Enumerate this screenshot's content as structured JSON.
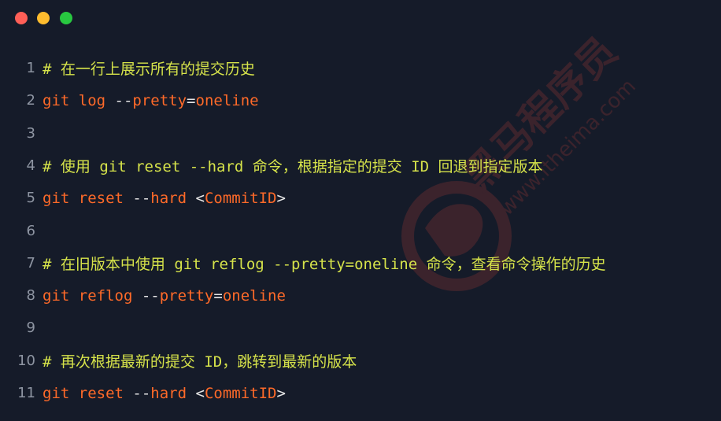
{
  "window": {
    "traffic_lights": {
      "close_color": "#ff5f57",
      "minimize_color": "#febc2e",
      "maximize_color": "#28c840"
    }
  },
  "watermark": {
    "text_cn": "黑马程序员",
    "text_url": "www.itheima.com",
    "color": "#5a2a30"
  },
  "colors": {
    "background": "#151b29",
    "comment": "#d6e34a",
    "command": "#ff6a29",
    "plain": "#e6e6e6",
    "line_number": "#8e95a2"
  },
  "code_lines": [
    {
      "number": "1",
      "comment": "# 在一行上展示所有的提交历史"
    },
    {
      "number": "2",
      "tokens": [
        {
          "t": "git log ",
          "c": "cmd"
        },
        {
          "t": "--",
          "c": "plain"
        },
        {
          "t": "pretty",
          "c": "cmd"
        },
        {
          "t": "=",
          "c": "plain"
        },
        {
          "t": "oneline",
          "c": "cmd"
        }
      ]
    },
    {
      "number": "3"
    },
    {
      "number": "4",
      "comment": "# 使用 git reset --hard 命令，根据指定的提交 ID 回退到指定版本"
    },
    {
      "number": "5",
      "tokens": [
        {
          "t": "git reset ",
          "c": "cmd"
        },
        {
          "t": "--",
          "c": "plain"
        },
        {
          "t": "hard ",
          "c": "cmd"
        },
        {
          "t": "<",
          "c": "plain"
        },
        {
          "t": "CommitID",
          "c": "cmd"
        },
        {
          "t": ">",
          "c": "plain"
        }
      ]
    },
    {
      "number": "6"
    },
    {
      "number": "7",
      "comment": "# 在旧版本中使用 git reflog --pretty=oneline 命令，查看命令操作的历史"
    },
    {
      "number": "8",
      "tokens": [
        {
          "t": "git reflog ",
          "c": "cmd"
        },
        {
          "t": "--",
          "c": "plain"
        },
        {
          "t": "pretty",
          "c": "cmd"
        },
        {
          "t": "=",
          "c": "plain"
        },
        {
          "t": "oneline",
          "c": "cmd"
        }
      ]
    },
    {
      "number": "9"
    },
    {
      "number": "10",
      "comment": "# 再次根据最新的提交 ID，跳转到最新的版本"
    },
    {
      "number": "11",
      "tokens": [
        {
          "t": "git reset ",
          "c": "cmd"
        },
        {
          "t": "--",
          "c": "plain"
        },
        {
          "t": "hard ",
          "c": "cmd"
        },
        {
          "t": "<",
          "c": "plain"
        },
        {
          "t": "CommitID",
          "c": "cmd"
        },
        {
          "t": ">",
          "c": "plain"
        }
      ]
    }
  ]
}
